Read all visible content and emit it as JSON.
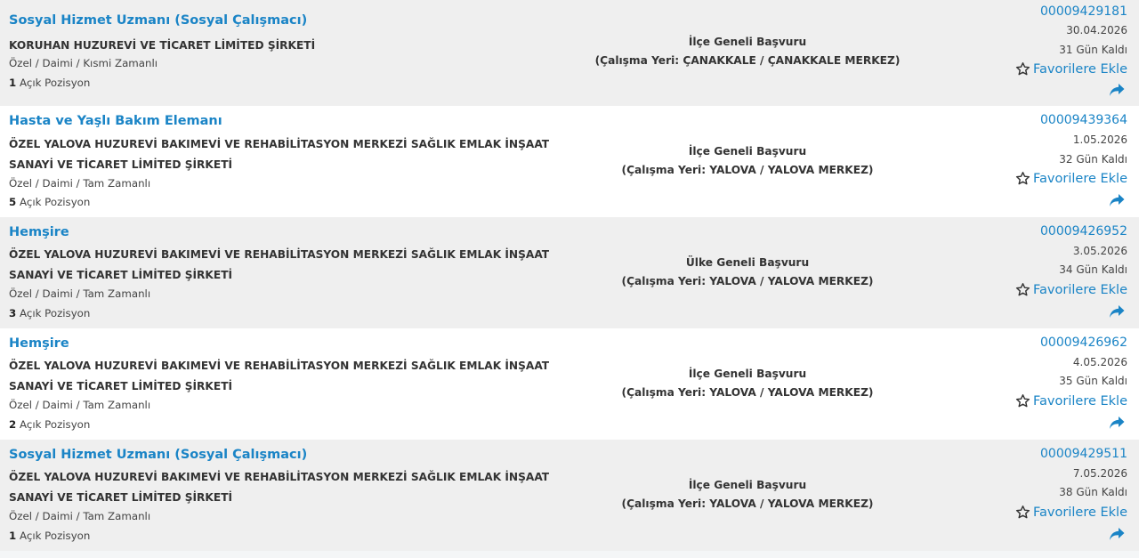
{
  "common": {
    "favorite_label": "Favorilere Ekle"
  },
  "listings": [
    {
      "title": "Sosyal Hizmet Uzmanı (Sosyal Çalışmacı)",
      "company": "KORUHAN HUZUREVİ VE TİCARET LİMİTED ŞİRKETİ",
      "employment": "Özel / Daimi / Kısmi Zamanlı",
      "positions_count": "1",
      "positions_label": "Açık Pozisyon",
      "application_type": "İlçe Geneli Başvuru",
      "workplace": "(Çalışma Yeri: ÇANAKKALE / ÇANAKKALE MERKEZ)",
      "job_number": "00009429181",
      "deadline": "30.04.2026",
      "days_left": "31 Gün Kaldı"
    },
    {
      "title": "Hasta ve Yaşlı Bakım Elemanı",
      "company": "ÖZEL YALOVA HUZUREVİ BAKIMEVİ VE REHABİLİTASYON MERKEZİ SAĞLIK EMLAK İNŞAAT SANAYİ VE TİCARET LİMİTED ŞİRKETİ",
      "employment": "Özel / Daimi / Tam Zamanlı",
      "positions_count": "5",
      "positions_label": "Açık Pozisyon",
      "application_type": "İlçe Geneli Başvuru",
      "workplace": "(Çalışma Yeri: YALOVA / YALOVA MERKEZ)",
      "job_number": "00009439364",
      "deadline": "1.05.2026",
      "days_left": "32 Gün Kaldı"
    },
    {
      "title": "Hemşire",
      "company": "ÖZEL YALOVA HUZUREVİ BAKIMEVİ VE REHABİLİTASYON MERKEZİ SAĞLIK EMLAK İNŞAAT SANAYİ VE TİCARET LİMİTED ŞİRKETİ",
      "employment": "Özel / Daimi / Tam Zamanlı",
      "positions_count": "3",
      "positions_label": "Açık Pozisyon",
      "application_type": "Ülke Geneli Başvuru",
      "workplace": "(Çalışma Yeri: YALOVA / YALOVA MERKEZ)",
      "job_number": "00009426952",
      "deadline": "3.05.2026",
      "days_left": "34 Gün Kaldı"
    },
    {
      "title": "Hemşire",
      "company": "ÖZEL YALOVA HUZUREVİ BAKIMEVİ VE REHABİLİTASYON MERKEZİ SAĞLIK EMLAK İNŞAAT SANAYİ VE TİCARET LİMİTED ŞİRKETİ",
      "employment": "Özel / Daimi / Tam Zamanlı",
      "positions_count": "2",
      "positions_label": "Açık Pozisyon",
      "application_type": "İlçe Geneli Başvuru",
      "workplace": "(Çalışma Yeri: YALOVA / YALOVA MERKEZ)",
      "job_number": "00009426962",
      "deadline": "4.05.2026",
      "days_left": "35 Gün Kaldı"
    },
    {
      "title": "Sosyal Hizmet Uzmanı (Sosyal Çalışmacı)",
      "company": "ÖZEL YALOVA HUZUREVİ BAKIMEVİ VE REHABİLİTASYON MERKEZİ SAĞLIK EMLAK İNŞAAT SANAYİ VE TİCARET LİMİTED ŞİRKETİ",
      "employment": "Özel / Daimi / Tam Zamanlı",
      "positions_count": "1",
      "positions_label": "Açık Pozisyon",
      "application_type": "İlçe Geneli Başvuru",
      "workplace": "(Çalışma Yeri: YALOVA / YALOVA MERKEZ)",
      "job_number": "00009429511",
      "deadline": "7.05.2026",
      "days_left": "38 Gün Kaldı"
    }
  ]
}
